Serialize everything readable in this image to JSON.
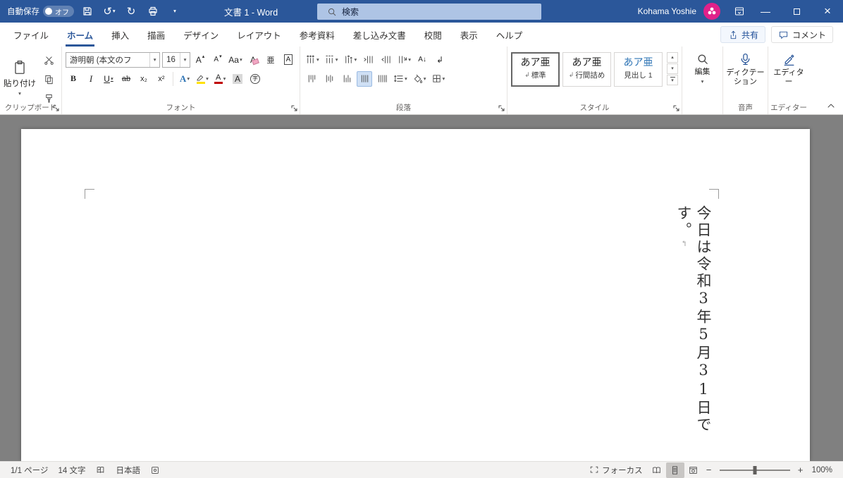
{
  "titlebar": {
    "autosave_label": "自動保存",
    "autosave_state": "オフ",
    "doc_title": "文書 1  -  Word",
    "search_placeholder": "検索",
    "user_name": "Kohama Yoshie"
  },
  "tabs": {
    "items": [
      "ファイル",
      "ホーム",
      "挿入",
      "描画",
      "デザイン",
      "レイアウト",
      "参考資料",
      "差し込み文書",
      "校閲",
      "表示",
      "ヘルプ"
    ],
    "share": "共有",
    "comments": "コメント"
  },
  "ribbon": {
    "clipboard": {
      "paste": "貼り付け",
      "label": "クリップボード"
    },
    "font": {
      "name": "游明朝 (本文のフ",
      "size": "16",
      "label": "フォント"
    },
    "paragraph": {
      "label": "段落"
    },
    "styles": {
      "label": "スタイル",
      "preview": "あア亜",
      "mark": "↲",
      "names": [
        "標準",
        "行間詰め",
        "見出し 1"
      ]
    },
    "editing": {
      "button": "編集"
    },
    "voice": {
      "button": "ディクテーション",
      "label": "音声"
    },
    "editor": {
      "button": "エディター",
      "label": "エディター"
    }
  },
  "glyphs": {
    "dropdown": "▾",
    "up": "▴",
    "undo": "↺",
    "redo": "↻",
    "minimize": "—",
    "close": "×",
    "bold": "B",
    "italic": "I",
    "underline": "U",
    "strikethrough": "ab",
    "subscript": "x₂",
    "superscript": "x²",
    "grow_font": "A",
    "shrink_font": "A",
    "change_case": "Aa",
    "clear_format": "A",
    "ruby": "亜",
    "enclose": "A",
    "text_effects": "A",
    "font_color": "A",
    "char_shading": "A",
    "circle_char": "字",
    "sort": "A↓",
    "marks": "↲",
    "para_mark": "↰"
  },
  "document": {
    "text": "今日は令和3年5月31日です。"
  },
  "statusbar": {
    "page": "1/1 ページ",
    "chars": "14 文字",
    "language": "日本語",
    "focus": "フォーカス",
    "zoom_out": "−",
    "zoom_in": "+",
    "zoom_level": "100%"
  }
}
